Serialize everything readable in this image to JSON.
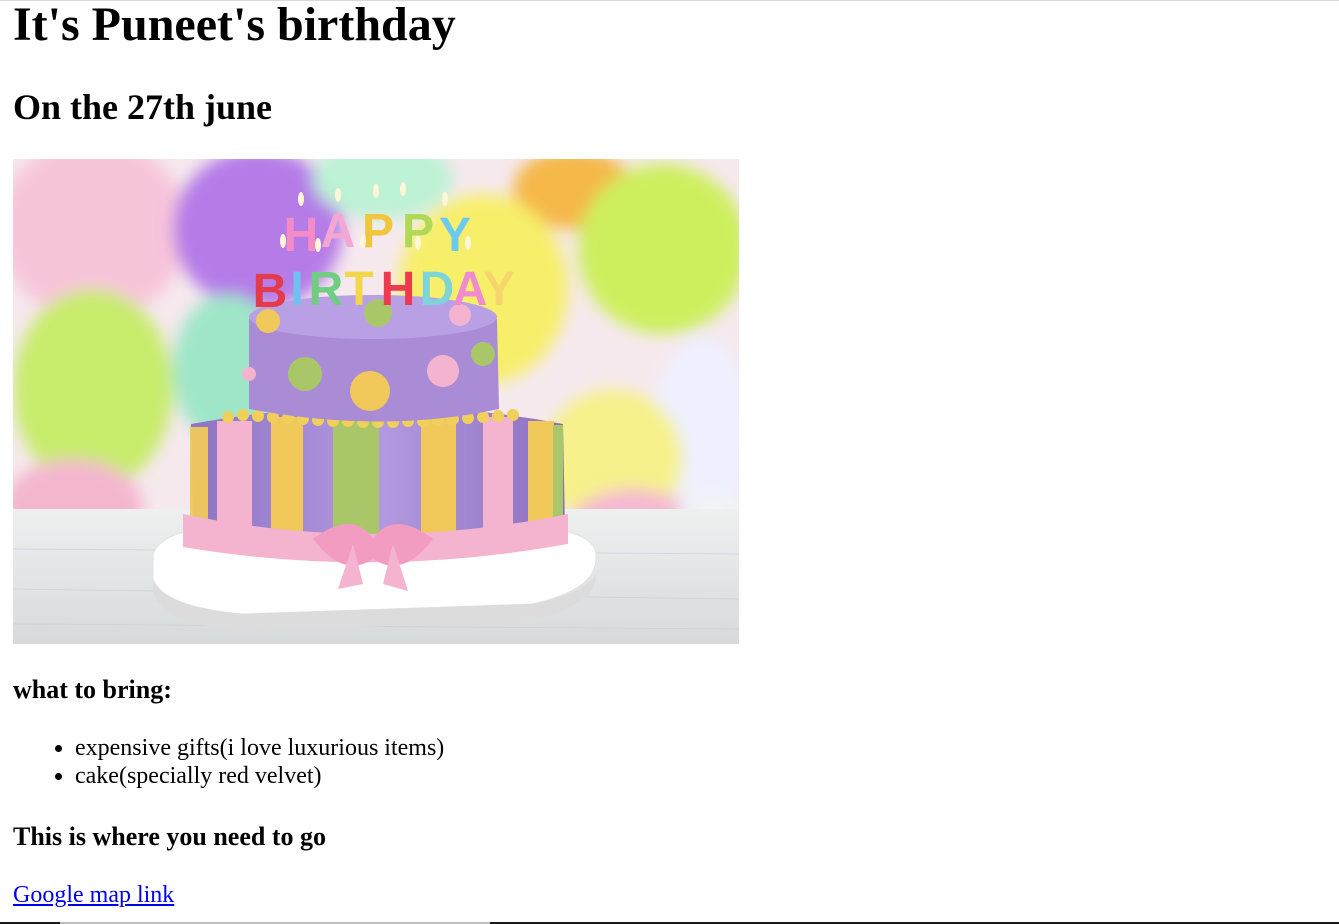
{
  "page": {
    "title": "It's Puneet's birthday",
    "subtitle": "On the 27th june",
    "hero_image": {
      "candle_letters_top": "HAPPY",
      "candle_letters_bottom": "BIRTHDAY",
      "colors": {
        "cake_purple": "#a98bd6",
        "icing_pink": "#f4b3cf",
        "stripe_yellow": "#f0c95a",
        "stripe_green": "#a9c769",
        "balloon_purple": "#b57ce8",
        "balloon_green": "#c7ea67",
        "balloon_yellow": "#f5ef72",
        "balloon_pink": "#f4bfd4"
      }
    },
    "bring_heading": "what to bring:",
    "bring_items": [
      "expensive gifts(i love luxurious items)",
      "cake(specially red velvet)"
    ],
    "where_heading": "This is where you need to go",
    "map_link_text": "Google map link",
    "link_color": "#0000ee"
  }
}
